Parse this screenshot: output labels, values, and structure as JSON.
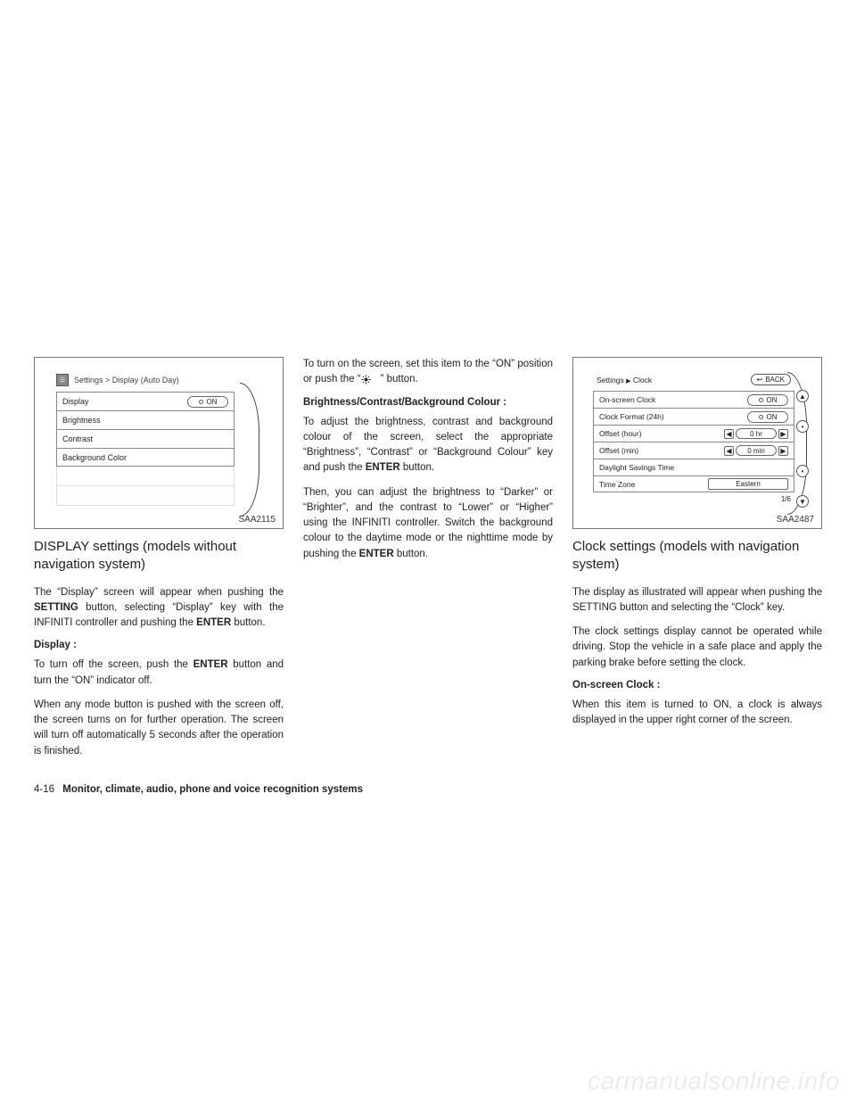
{
  "footer": {
    "page_number": "4-16",
    "chapter": "Monitor, climate, audio, phone and voice recognition systems"
  },
  "watermark": "carmanualsonline.info",
  "column1": {
    "figure": {
      "caption": "SAA2115",
      "breadcrumb": "Settings > Display (Auto Day)",
      "rows": [
        {
          "label": "Display",
          "pill": "ON"
        },
        {
          "label": "Brightness"
        },
        {
          "label": "Contrast"
        },
        {
          "label": "Background Color"
        }
      ]
    },
    "heading": "DISPLAY settings (models without navigation system)",
    "p1_a": "The “Display” screen will appear when pushing the ",
    "p1_b": "SETTING",
    "p1_c": " button, selecting “Display” key with the INFINITI controller and pushing the ",
    "p1_d": "ENTER",
    "p1_e": " button.",
    "label1": "Display :",
    "p2_a": "To turn off the screen, push the ",
    "p2_b": "ENTER",
    "p2_c": " button and turn the “ON” indicator off.",
    "p3": "When any mode button is pushed with the screen off, the screen turns on for further operation. The screen will turn off automatically 5 seconds after the operation is finished."
  },
  "column2": {
    "p1": "To turn on the screen, set this item to the “ON” position or push the “",
    "p1_end": "” button.",
    "label1": "Brightness/Contrast/Background Colour :",
    "p2_a": "To adjust the brightness, contrast and background colour of the screen, select the appropriate “Brightness”, “Contrast” or “Background Colour” key and push the ",
    "p2_b": "ENTER",
    "p2_c": " button.",
    "p3_a": "Then, you can adjust the brightness to “Darker” or “Brighter”, and the contrast to “Lower” or “Higher” using the INFINITI controller. Switch the background colour to the daytime mode or the nighttime mode by pushing the ",
    "p3_b": "ENTER",
    "p3_c": " button."
  },
  "column3": {
    "figure": {
      "caption": "SAA2487",
      "breadcrumb_a": "Settings",
      "breadcrumb_b": "Clock",
      "back": "BACK",
      "rows": [
        {
          "label": "On-screen Clock",
          "type": "pill",
          "value": "ON"
        },
        {
          "label": "Clock Format (24h)",
          "type": "pill",
          "value": "ON"
        },
        {
          "label": "Offset (hour)",
          "type": "stepper",
          "value": "0 hr"
        },
        {
          "label": "Offset (min)",
          "type": "stepper",
          "value": "0 min"
        },
        {
          "label": "Daylight Savings Time",
          "type": "none"
        },
        {
          "label": "Time Zone",
          "type": "tz",
          "value": "Eastern"
        }
      ],
      "page_indicator": "1/6"
    },
    "heading": "Clock settings (models with navigation system)",
    "p1": "The display as illustrated will appear when pushing the SETTING button and selecting the “Clock” key.",
    "p2": "The clock settings display cannot be operated while driving. Stop the vehicle in a safe place and apply the parking brake before setting the clock.",
    "label1": "On-screen Clock :",
    "p3": "When this item is turned to ON, a clock is always displayed in the upper right corner of the screen."
  }
}
